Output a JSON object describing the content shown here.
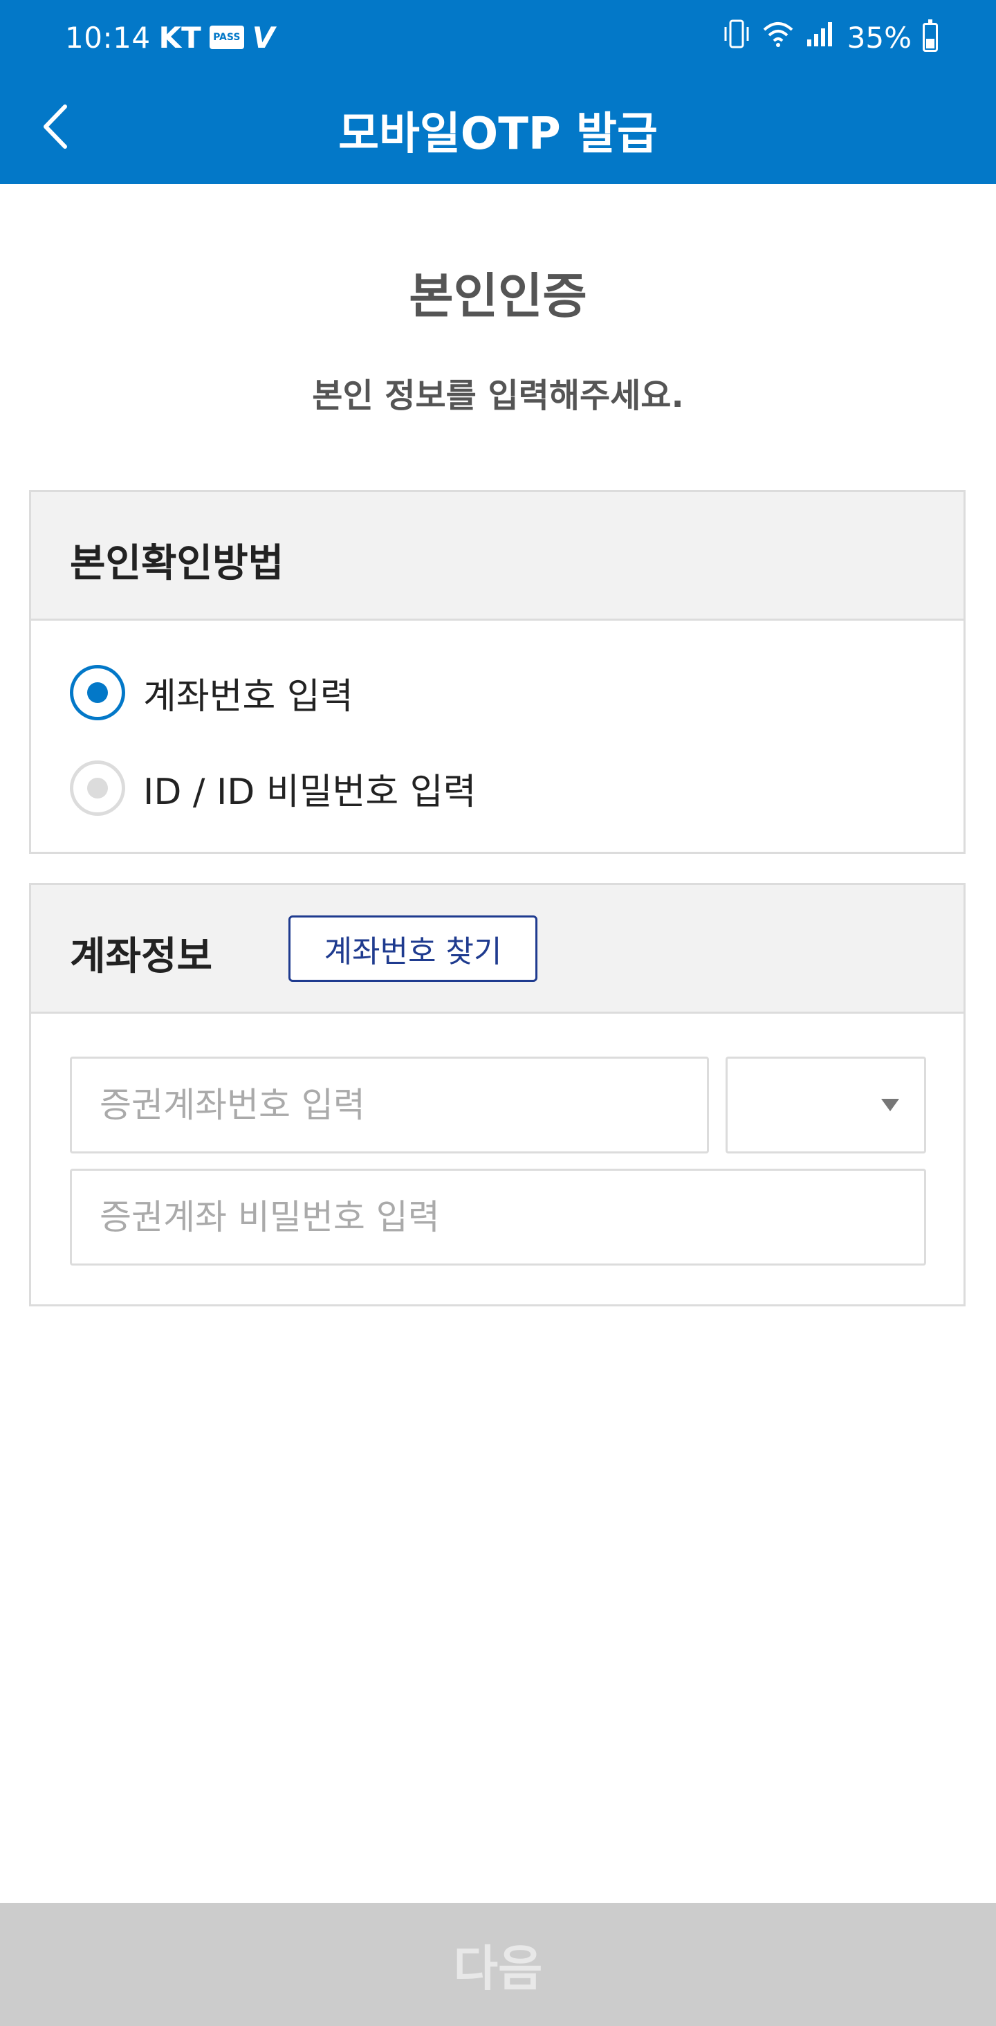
{
  "status_bar": {
    "time": "10:14",
    "carrier": "KT",
    "pass_badge": "PASS",
    "v_badge": "V",
    "battery_percent": "35%",
    "icons": [
      "vibrate-icon",
      "wifi-icon",
      "signal-icon",
      "battery-icon"
    ]
  },
  "header": {
    "title": "모바일OTP 발급",
    "back_icon": "chevron-left-icon",
    "background": "#0378c8"
  },
  "intro": {
    "title": "본인인증",
    "subtitle": "본인 정보를 입력해주세요."
  },
  "verify_method": {
    "label": "본인확인방법",
    "options": [
      {
        "label": "계좌번호 입력",
        "selected": true
      },
      {
        "label": "ID / ID 비밀번호 입력",
        "selected": false
      }
    ]
  },
  "account_info": {
    "label": "계좌정보",
    "find_button": "계좌번호 찾기",
    "account_placeholder": "증권계좌번호 입력",
    "account_value": "",
    "select_value": "",
    "password_placeholder": "증권계좌 비밀번호 입력",
    "password_value": ""
  },
  "footer": {
    "next_label": "다음",
    "enabled": false
  },
  "colors": {
    "accent": "#0378c8",
    "find_button_border": "#1f3b8f",
    "disabled_button": "#cccccc"
  }
}
